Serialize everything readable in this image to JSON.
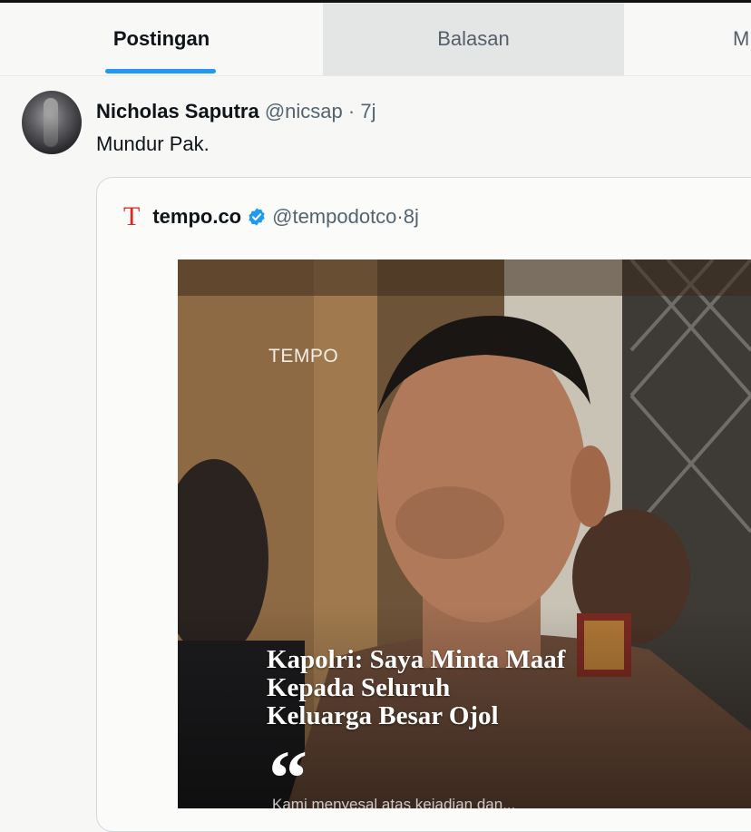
{
  "tabs": [
    {
      "label": "Postingan",
      "active": true
    },
    {
      "label": "Balasan",
      "active": false
    },
    {
      "label": "M",
      "active": false
    }
  ],
  "colors": {
    "accent": "#1d9bf0",
    "tempo_red": "#d62b2b",
    "muted": "#536471"
  },
  "tweet": {
    "author_name": "Nicholas Saputra",
    "handle": "@nicsap",
    "separator": " · ",
    "time": "7j",
    "text": "Mundur Pak."
  },
  "quote": {
    "logo_glyph": "T",
    "name": "tempo.co",
    "verified_icon": "verified-badge-icon",
    "handle": "@tempodotco",
    "separator": " · ",
    "time": "8j",
    "media": {
      "watermark": "TEMPO",
      "headline": [
        "Kapolri: Saya Minta Maaf",
        "Kepada Seluruh",
        "Keluarga Besar Ojol"
      ],
      "quote_mark": "“",
      "subtext": "Kami menyesal atas kejadian dan..."
    }
  }
}
